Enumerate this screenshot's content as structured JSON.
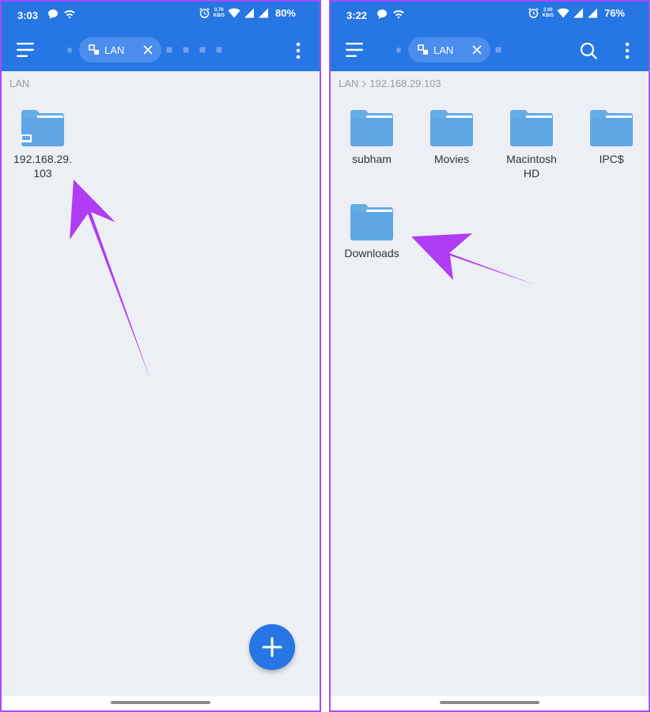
{
  "left": {
    "status": {
      "time": "3:03",
      "speed_value": "0.76",
      "speed_unit": "KB/S",
      "battery": "80%"
    },
    "tab": {
      "label": "LAN"
    },
    "breadcrumb": {
      "root": "LAN"
    },
    "items": [
      {
        "label_line1": "192.168.29.",
        "label_line2": "103"
      }
    ],
    "fab": {
      "symbol": "+"
    }
  },
  "right": {
    "status": {
      "time": "3:22",
      "speed_value": "2.00",
      "speed_unit": "KB/S",
      "battery": "76%"
    },
    "tab": {
      "label": "LAN"
    },
    "breadcrumb": {
      "root": "LAN",
      "current": "192.168.29.103"
    },
    "items": [
      {
        "label": "subham"
      },
      {
        "label": "Movies"
      },
      {
        "label_line1": "Macintosh",
        "label_line2": "HD"
      },
      {
        "label": "IPC$"
      },
      {
        "label": "Downloads"
      }
    ]
  },
  "colors": {
    "app_bar": "#2676e4",
    "folder": "#64aee8",
    "annotation_arrow": "#b03cf5",
    "frame": "#a64cff"
  }
}
